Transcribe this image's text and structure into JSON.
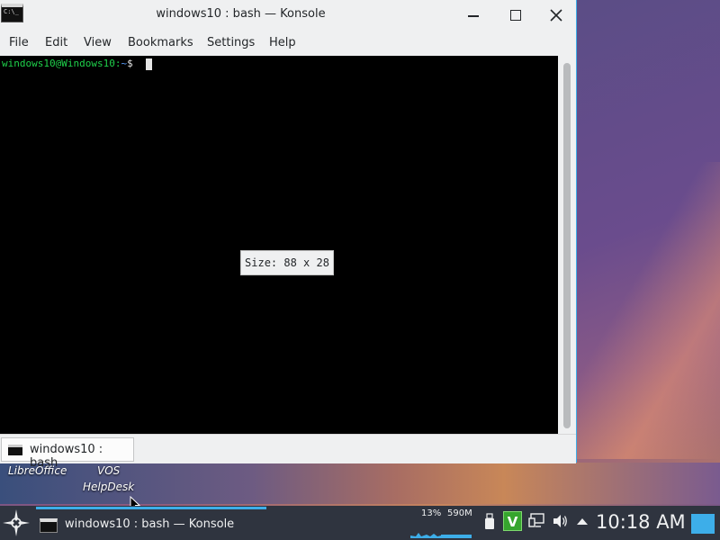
{
  "window": {
    "title": "windows10 : bash — Konsole",
    "icon_label": "C:\\_"
  },
  "menubar": {
    "items": [
      "File",
      "Edit",
      "View",
      "Bookmarks",
      "Settings",
      "Help"
    ]
  },
  "terminal": {
    "prompt_user": "windows10@Windows10:",
    "prompt_path": "~",
    "prompt_symbol": "$",
    "size_tooltip": "Size: 88 x 28"
  },
  "tabs": [
    {
      "label": "windows10 : bash"
    }
  ],
  "desktop": {
    "icons": [
      "LibreOffice",
      "VOS HelpDesk"
    ],
    "icon_labels": {
      "libreoffice": "LibreOffice",
      "vos_line1": "VOS",
      "vos_line2": "HelpDesk"
    }
  },
  "taskbar": {
    "task_label": "windows10 : bash — Konsole",
    "cpu": "13%",
    "memory": "590M",
    "tray_v": "V",
    "clock": "10:18 AM"
  },
  "colors": {
    "accent": "#3daee9",
    "prompt_green": "#1fd14b",
    "panel": "#2f343f",
    "vendor_green": "#36a52e"
  },
  "icons": {
    "launcher": "kde-launcher-icon",
    "tray": [
      "usb-icon",
      "vendor-v-icon",
      "network-icon",
      "volume-icon",
      "tray-expand-icon"
    ]
  }
}
